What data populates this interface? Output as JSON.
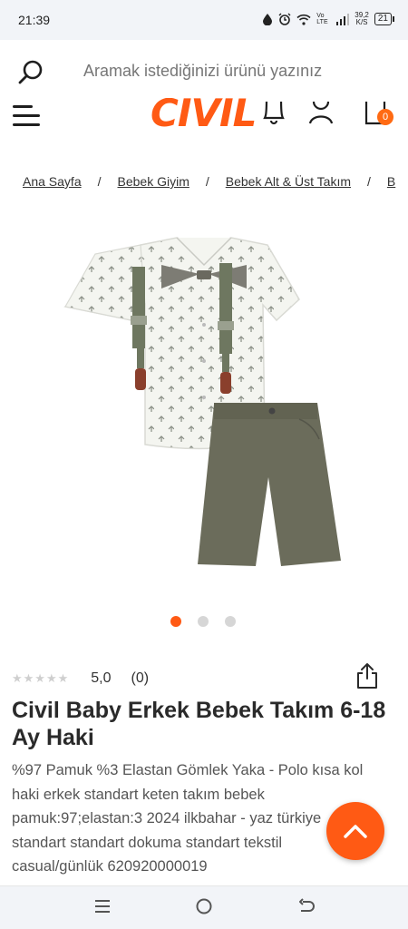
{
  "status_bar": {
    "time": "21:39",
    "net_speed_value": "39,2",
    "net_speed_unit": "K/S",
    "network_label": "Vo LTE",
    "battery": "21"
  },
  "search": {
    "placeholder": "Aramak istediğinizi ürünü yazınız"
  },
  "header": {
    "logo": "CIVIL",
    "cart_count": "0"
  },
  "breadcrumb": {
    "items": [
      "Ana Sayfa",
      "Bebek Giyim",
      "Bebek Alt & Üst Takım",
      "B"
    ],
    "separator": "/"
  },
  "gallery": {
    "image_count": 3,
    "active_index": 0
  },
  "rating": {
    "stars": "★★★★★",
    "value": "5,0",
    "count": "(0)"
  },
  "product": {
    "title": "Civil Baby Erkek Bebek Takım 6-18 Ay Haki",
    "description": "%97 Pamuk %3 Elastan Gömlek Yaka - Polo kısa kol haki erkek standart keten takım bebek pamuk:97;elastan:3 2024 ilkbahar - yaz türkiye standart standart dokuma standart tekstil casual/günlük 620920000019"
  },
  "colors": {
    "accent": "#ff5a14",
    "text": "#2a2a2a"
  },
  "icons": [
    "search-icon",
    "menu-icon",
    "bell-icon",
    "user-icon",
    "cart-icon",
    "share-icon",
    "chevron-up-icon",
    "nav-menu-icon",
    "nav-home-icon",
    "nav-back-icon"
  ]
}
